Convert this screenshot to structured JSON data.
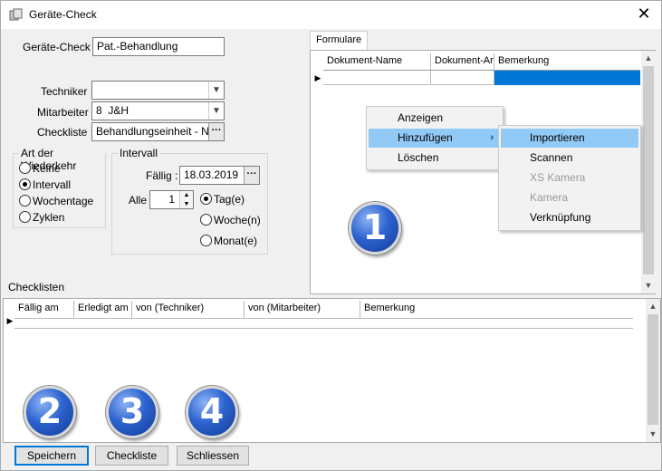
{
  "window": {
    "title": "Geräte-Check",
    "close_symbol": "✕"
  },
  "form": {
    "geraete_check_label": "Geräte-Check :",
    "geraete_check_value": "Pat.-Behandlung",
    "techniker_label": "Techniker :",
    "techniker_value": "",
    "mitarbeiter_label": "Mitarbeiter :",
    "mitarbeiter_value": "8  J&H",
    "checkliste_label": "Checkliste :",
    "checkliste_value": "Behandlungseinheit - Nach",
    "ellipsis": "···"
  },
  "wiederkehr": {
    "title": "Art der Wiederkehr",
    "options": [
      "Keine",
      "Intervall",
      "Wochentage",
      "Zyklen"
    ],
    "selected": "Intervall"
  },
  "intervall": {
    "title": "Intervall",
    "faellig_label": "Fällig :",
    "faellig_value": "18.03.2019",
    "alle_label": "Alle",
    "alle_value": "1",
    "units": [
      "Tag(e)",
      "Woche(n)",
      "Monat(e)"
    ],
    "selected_unit": "Tag(e)"
  },
  "checklisten_label": "Checklisten",
  "formulare": {
    "tab_label": "Formulare",
    "columns": [
      "Dokument-Name",
      "Dokument-Art",
      "Bemerkung"
    ]
  },
  "context_menu": {
    "items": [
      "Anzeigen",
      "Hinzufügen",
      "Löschen"
    ],
    "highlighted": "Hinzufügen",
    "submenu_arrow": "›",
    "submenu": [
      {
        "label": "Importieren",
        "enabled": true
      },
      {
        "label": "Scannen",
        "enabled": true
      },
      {
        "label": "XS Kamera",
        "enabled": false
      },
      {
        "label": "Kamera",
        "enabled": false
      },
      {
        "label": "Verknüpfung",
        "enabled": true
      }
    ]
  },
  "checklist_table": {
    "columns": [
      "Fällig am",
      "Erledigt am",
      "von (Techniker)",
      "von (Mitarbeiter)",
      "Bemerkung"
    ]
  },
  "badges": [
    "1",
    "2",
    "3",
    "4"
  ],
  "buttons": {
    "speichern": "Speichern",
    "checkliste": "Checkliste",
    "schliessen": "Schliessen"
  },
  "colors": {
    "highlight": "#91c9f7",
    "selection_blue": "#0078d7",
    "badge_blue": "#2d63cf"
  }
}
